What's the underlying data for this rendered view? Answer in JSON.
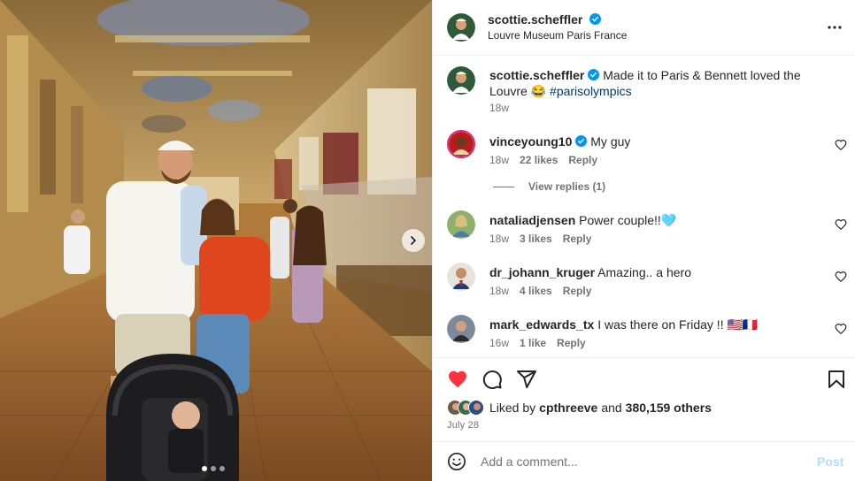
{
  "post": {
    "author": "scottie.scheffler",
    "location": "Louvre Museum Paris France",
    "caption_text": "Made it to Paris & Bennett loved the Louvre 😂 ",
    "caption_hashtag": "#parisolympics",
    "caption_time": "18w"
  },
  "comments": [
    {
      "user": "vinceyoung10",
      "verified": true,
      "text": "My guy",
      "time": "18w",
      "likes": "22 likes",
      "reply": "Reply",
      "view_replies": "View replies (1)"
    },
    {
      "user": "nataliadjensen",
      "verified": false,
      "text": "Power couple!!🩵",
      "time": "18w",
      "likes": "3 likes",
      "reply": "Reply"
    },
    {
      "user": "dr_johann_kruger",
      "verified": false,
      "text": "Amazing.. a hero",
      "time": "18w",
      "likes": "4 likes",
      "reply": "Reply"
    },
    {
      "user": "mark_edwards_tx",
      "verified": false,
      "text": "I was there on Friday !! 🇺🇸🇫🇷",
      "time": "16w",
      "likes": "1 like",
      "reply": "Reply"
    }
  ],
  "likes": {
    "prefix": "Liked by ",
    "user": "cpthreeve",
    "middle": " and ",
    "count": "380,159 others"
  },
  "date": "July 28",
  "add_comment": {
    "placeholder": "Add a comment...",
    "post_label": "Post"
  },
  "icons": {
    "heart": "heart-filled-icon",
    "comment": "comment-icon",
    "share": "share-icon",
    "save": "bookmark-icon",
    "more": "more-horizontal-icon",
    "emoji": "emoji-icon",
    "carousel_next": "chevron-right-icon"
  },
  "carousel": {
    "current": 1,
    "total": 3
  },
  "colors": {
    "like_red": "#ff3040",
    "verified_blue": "#0095f6",
    "link_blue": "#00376b",
    "post_disabled": "#b2dffc"
  }
}
